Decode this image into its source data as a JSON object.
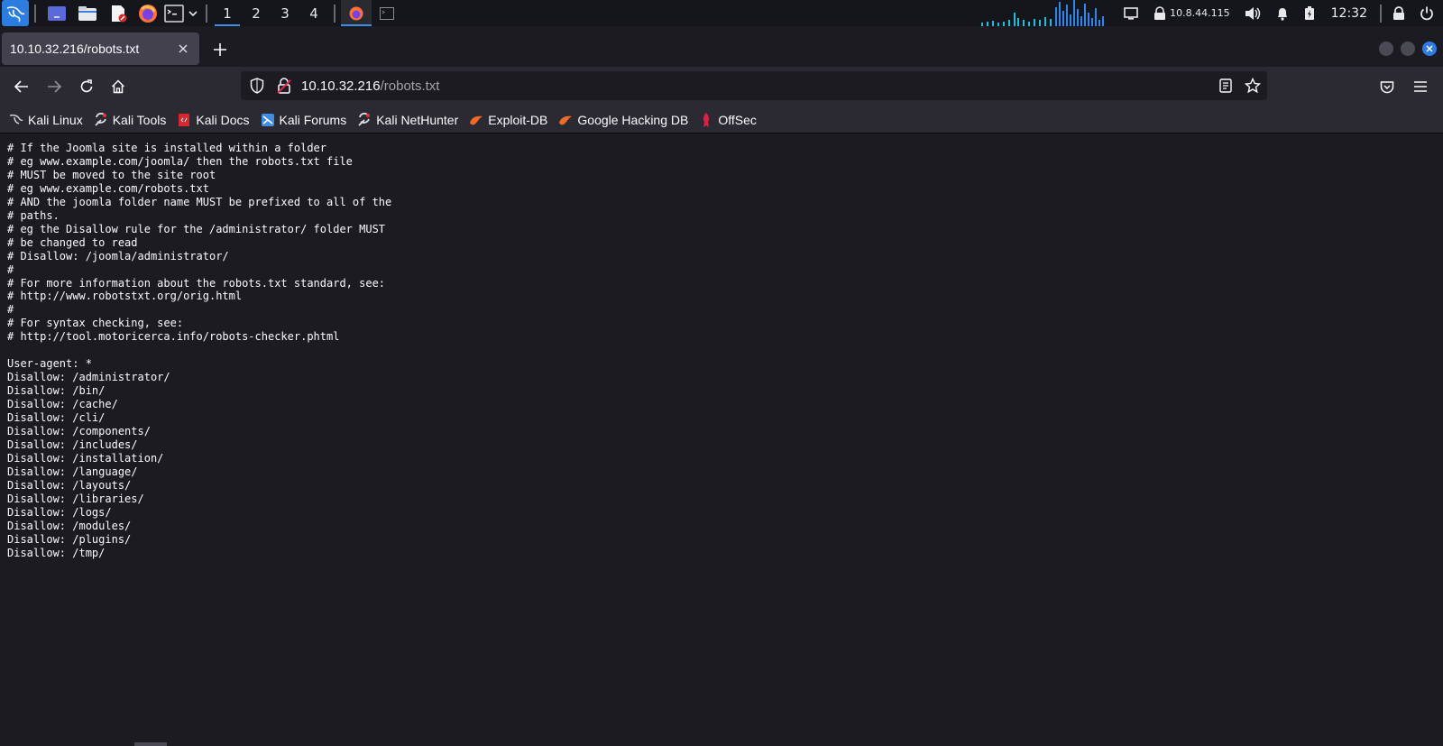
{
  "panel": {
    "workspaces": [
      "1",
      "2",
      "3",
      "4"
    ],
    "active_workspace": "1",
    "network_ip": "10.8.44.115",
    "clock": "12:32",
    "accent": "#2b7de1"
  },
  "browser": {
    "tab": {
      "title": "10.10.32.216/robots.txt",
      "close_icon": "close-icon"
    },
    "url": {
      "host": "10.10.32.216",
      "path": "/robots.txt"
    },
    "bookmarks": [
      {
        "label": "Kali Linux",
        "icon": "kali-dragon-icon"
      },
      {
        "label": "Kali Tools",
        "icon": "kali-tools-icon"
      },
      {
        "label": "Kali Docs",
        "icon": "kali-docs-icon"
      },
      {
        "label": "Kali Forums",
        "icon": "kali-forums-icon"
      },
      {
        "label": "Kali NetHunter",
        "icon": "kali-nethunter-icon"
      },
      {
        "label": "Exploit-DB",
        "icon": "exploit-db-icon"
      },
      {
        "label": "Google Hacking DB",
        "icon": "ghdb-icon"
      },
      {
        "label": "OffSec",
        "icon": "offsec-icon"
      }
    ]
  },
  "page": {
    "text": "# If the Joomla site is installed within a folder\n# eg www.example.com/joomla/ then the robots.txt file\n# MUST be moved to the site root\n# eg www.example.com/robots.txt\n# AND the joomla folder name MUST be prefixed to all of the\n# paths.\n# eg the Disallow rule for the /administrator/ folder MUST\n# be changed to read\n# Disallow: /joomla/administrator/\n#\n# For more information about the robots.txt standard, see:\n# http://www.robotstxt.org/orig.html\n#\n# For syntax checking, see:\n# http://tool.motoricerca.info/robots-checker.phtml\n\nUser-agent: *\nDisallow: /administrator/\nDisallow: /bin/\nDisallow: /cache/\nDisallow: /cli/\nDisallow: /components/\nDisallow: /includes/\nDisallow: /installation/\nDisallow: /language/\nDisallow: /layouts/\nDisallow: /libraries/\nDisallow: /logs/\nDisallow: /modules/\nDisallow: /plugins/\nDisallow: /tmp/"
  }
}
